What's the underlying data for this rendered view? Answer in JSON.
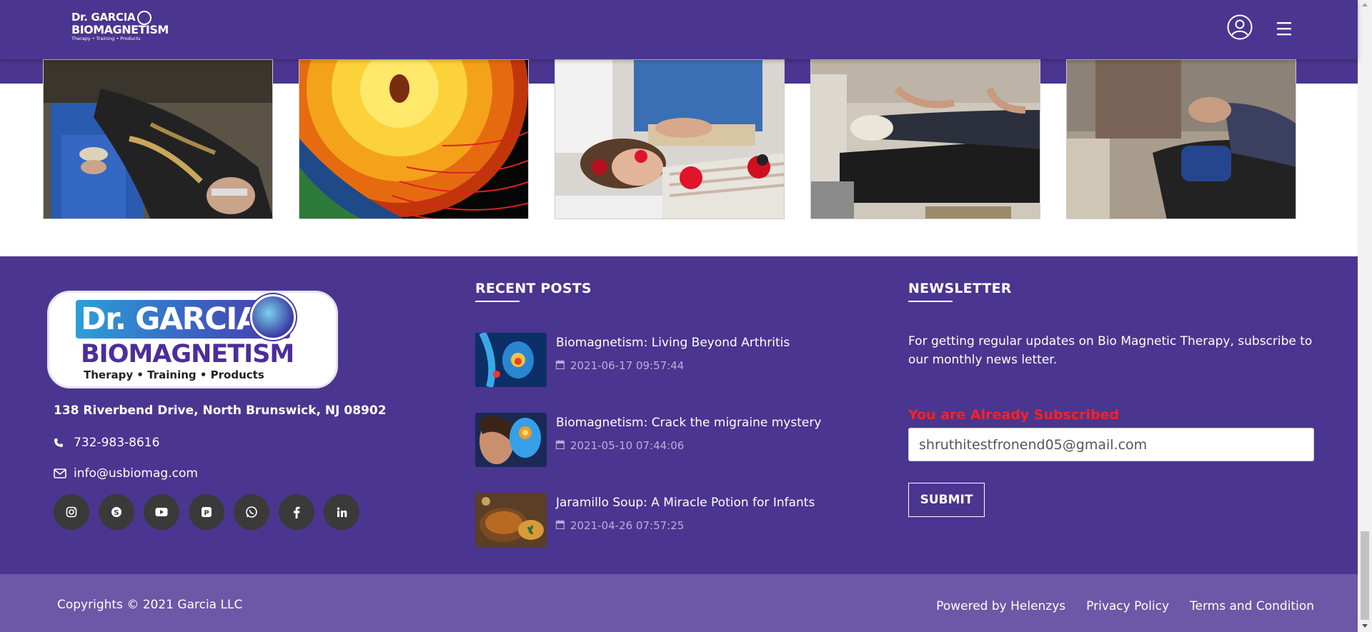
{
  "header": {
    "logo": {
      "line1": "Dr. GARCIA",
      "line2": "BIOMAGNETISM",
      "line3": "Therapy • Training • Products"
    },
    "user_icon": "user-circle-icon",
    "menu_icon": "hamburger-menu-icon",
    "bg_color": "#4a3590"
  },
  "gallery": {
    "photos": [
      {
        "alt": "Patient lying on therapy table"
      },
      {
        "alt": "Sun and earth magnetic field"
      },
      {
        "alt": "Woman receiving magnet therapy"
      },
      {
        "alt": "Therapist with patient on table"
      },
      {
        "alt": "Therapist treating patient"
      }
    ]
  },
  "footer": {
    "logo": {
      "line1": "Dr. GARCIA",
      "line2": "BIOMAGNETISM",
      "line3": "Therapy • Training • Products"
    },
    "address": "138 Riverbend Drive, North Brunswick, NJ 08902",
    "phone": "732-983-8616",
    "email": "info@usbiomag.com",
    "socials": [
      "instagram-icon",
      "skype-icon",
      "youtube-icon",
      "pinterest-icon",
      "whatsapp-icon",
      "facebook-icon",
      "linkedin-icon"
    ],
    "recent_posts": {
      "title": "RECENT POSTS",
      "items": [
        {
          "title": "Biomagnetism: Living Beyond Arthritis",
          "date": "2021-06-17 09:57:44"
        },
        {
          "title": "Biomagnetism: Crack the migraine mystery",
          "date": "2021-05-10 07:44:06"
        },
        {
          "title": "Jaramillo Soup: A Miracle Potion for Infants",
          "date": "2021-04-26 07:57:25"
        }
      ]
    },
    "newsletter": {
      "title": "NEWSLETTER",
      "text": "For getting regular updates on Bio Magnetic Therapy, subscribe to our monthly news letter.",
      "status": "You are Already Subscribed",
      "email_value": "shruthitestfronend05@gmail.com",
      "submit_label": "SUBMIT",
      "status_color": "#ff2020"
    }
  },
  "bottom_bar": {
    "copyright": "Copyrights © 2021 Garcia LLC",
    "links": [
      "Powered by Helenzys",
      "Privacy Policy",
      "Terms and Condition"
    ],
    "bg_color": "#6c58a6"
  }
}
